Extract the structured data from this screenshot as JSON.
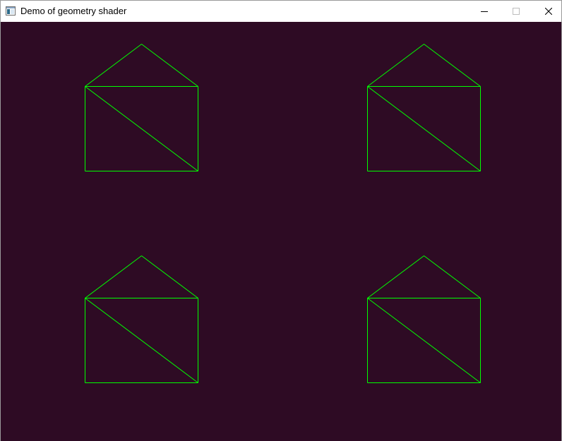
{
  "window": {
    "title": "Demo of geometry shader",
    "icon": "console-window-icon",
    "controls": {
      "minimize": "minimize-icon",
      "maximize": "maximize-icon",
      "close": "close-icon"
    }
  },
  "viewport": {
    "clear_color": "#2e0b24",
    "line_color": "#00ff00",
    "shape": "house-wireframe",
    "instances": [
      "top-left",
      "top-right",
      "bottom-left",
      "bottom-right"
    ]
  }
}
